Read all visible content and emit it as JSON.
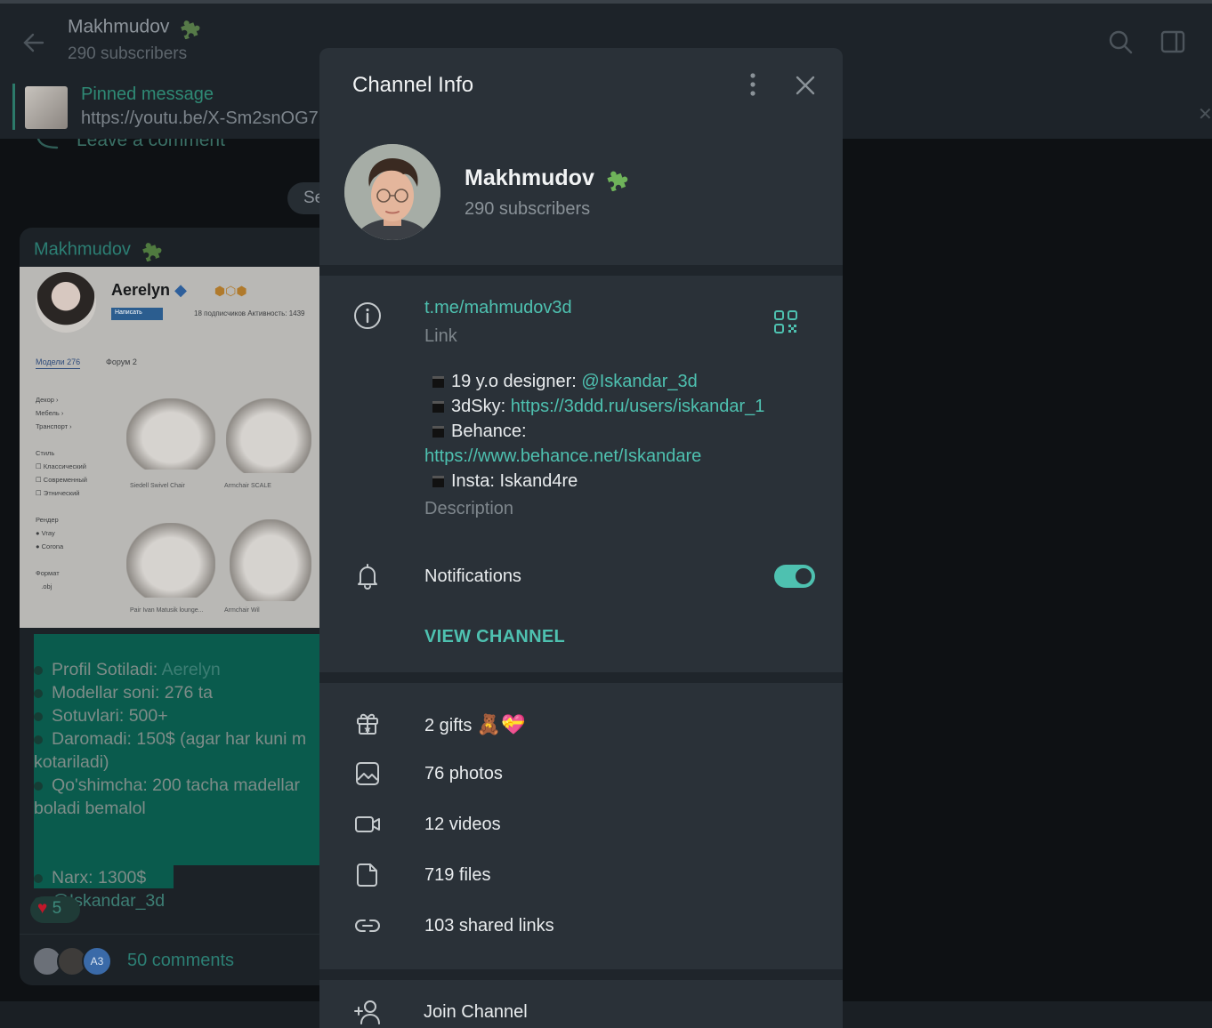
{
  "chat": {
    "title": "Makhmudov",
    "subscribers": "290 subscribers",
    "pinned_title": "Pinned message",
    "pinned_text": "https://youtu.be/X-Sm2snOG7",
    "leave_comment": "Leave a comment",
    "date_chip": "Se",
    "message": {
      "author": "Makhmudov",
      "image": {
        "name": "Aerelyn",
        "write_button": "Написать",
        "meta": "18 подписчиков     Активность: 1439",
        "tab_models": "Модели 276",
        "tab_forum": "Форум 2",
        "side_menu": "Декор ›\nМебель ›\nТранспорт ›\n\nСтиль\n☐ Классический\n☐ Современный\n☐ Этнический\n\nРендер\n● Vray\n● Corona\n\nФормат\n   .obj",
        "chair_labels": [
          "Siedell Swivel Chair",
          "Armchair SCALE",
          "Pair Ivan Matusik lounge...",
          "Armchair Wil"
        ]
      },
      "lines": [
        "Profil Sotiladi: ",
        "Modellar soni: 276 ta",
        "Sotuvlari: 500+",
        "Daromadi: 150$ (agar har kuni m",
        "kotariladi)",
        "Qo'shimcha: 200 tacha madellar",
        "boladi bemalol",
        "",
        "",
        "Narx: 1300$",
        "@Iskandar_3d"
      ],
      "profile_mention": "Aerelyn",
      "reaction_count": "5",
      "avatar_initials": "A3",
      "comments": "50 comments"
    }
  },
  "modal": {
    "title": "Channel Info",
    "name": "Makhmudov",
    "subscribers": "290 subscribers",
    "link_value": "t.me/mahmudov3d",
    "link_label": "Link",
    "description": {
      "line1_prefix": "19 y.o designer: ",
      "line1_link": "@Iskandar_3d",
      "line2_prefix": "3dSky: ",
      "line2_link": "https://3ddd.ru/users/iskandar_1",
      "line3_prefix": "Behance:",
      "line4_link": "https://www.behance.net/Iskandare",
      "line5": "Insta: Iskand4re",
      "label": "Description"
    },
    "notifications_label": "Notifications",
    "notifications_on": true,
    "view_channel": "VIEW CHANNEL",
    "gifts": "2 gifts",
    "photos": "76 photos",
    "videos": "12 videos",
    "files": "719 files",
    "shared_links": "103 shared links",
    "join": "Join Channel"
  },
  "colors": {
    "accent": "#4ec1b0",
    "modal_bg": "#2a3138",
    "separator": "#1f252b",
    "chat_bg": "#0e1114"
  }
}
